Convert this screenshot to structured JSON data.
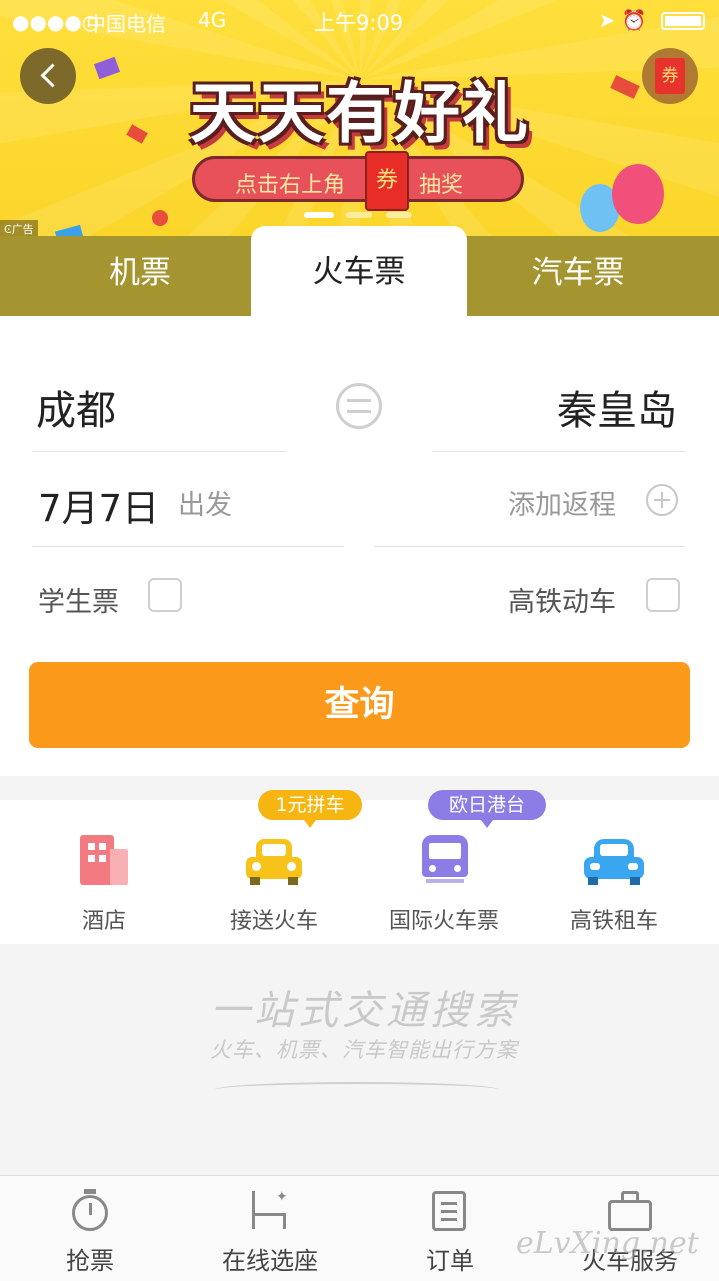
{
  "status_bar": {
    "signal": "●●●●○",
    "carrier": "中国电信",
    "network": "4G",
    "time": "上午9:09",
    "right_icons": "➤ ⏰"
  },
  "banner": {
    "title": "天天有好礼",
    "pill_left": "点击右上角",
    "pill_coupon": "券",
    "pill_right": "抽奖",
    "coupon_button": "券",
    "ad_tag": "广告"
  },
  "tabs": [
    {
      "label": "机票",
      "active": false
    },
    {
      "label": "火车票",
      "active": true
    },
    {
      "label": "汽车票",
      "active": false
    }
  ],
  "form": {
    "from_city": "成都",
    "to_city": "秦皇岛",
    "date": "7月7日",
    "depart_label": "出发",
    "return_label": "添加返程",
    "student_label": "学生票",
    "highspeed_label": "高铁动车",
    "search_label": "查询"
  },
  "services": [
    {
      "label": "酒店",
      "icon": "hotel-icon",
      "badge": ""
    },
    {
      "label": "接送火车",
      "icon": "taxi-icon",
      "badge": "1元拼车"
    },
    {
      "label": "国际火车票",
      "icon": "train-icon",
      "badge": "欧日港台"
    },
    {
      "label": "高铁租车",
      "icon": "car-icon",
      "badge": ""
    }
  ],
  "slogan": {
    "main": "一站式交通搜索",
    "sub": "火车、机票、汽车智能出行方案"
  },
  "bottom_nav": [
    {
      "label": "抢票",
      "icon": "stopwatch-icon"
    },
    {
      "label": "在线选座",
      "icon": "seat-icon"
    },
    {
      "label": "订单",
      "icon": "order-list-icon"
    },
    {
      "label": "火车服务",
      "icon": "briefcase-icon"
    }
  ],
  "watermark": "eLvXing.net",
  "colors": {
    "banner": "#fbd52a",
    "tabbar": "#a59530",
    "search_button": "#fb9a1a",
    "badge_yellow": "#f7b512",
    "badge_purple": "#8c7ce6"
  }
}
